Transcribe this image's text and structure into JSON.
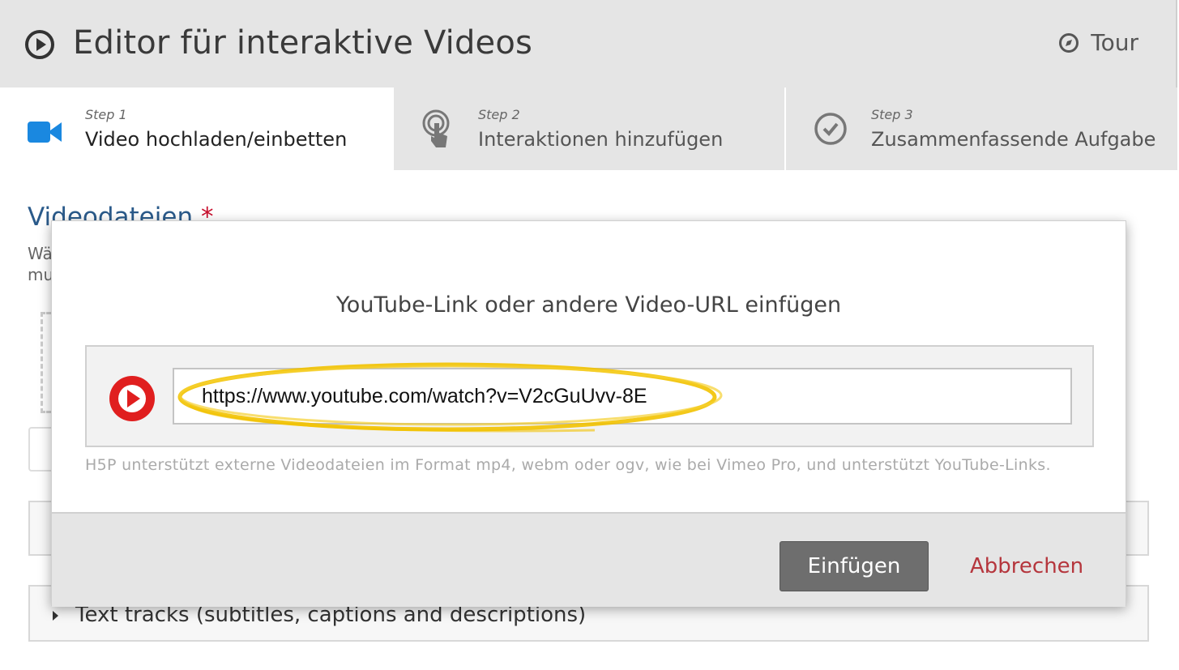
{
  "header": {
    "title": "Editor für interaktive Videos",
    "tour_label": "Tour"
  },
  "steps": [
    {
      "number": "Step 1",
      "label": "Video hochladen/einbetten",
      "icon": "video-camera-icon",
      "active": true
    },
    {
      "number": "Step 2",
      "label": "Interaktionen hinzufügen",
      "icon": "touch-hand-icon",
      "active": false
    },
    {
      "number": "Step 3",
      "label": "Zusammenfassende Aufgabe",
      "icon": "check-circle-icon",
      "active": false
    }
  ],
  "background": {
    "field_title": "Videodateien",
    "required_mark": "*",
    "description_line1": "Wä",
    "description_line2": "mu",
    "text_tracks_label": "Text tracks (subtitles, captions and descriptions)"
  },
  "modal": {
    "title": "YouTube-Link oder andere Video-URL einfügen",
    "url_value": "https://www.youtube.com/watch?v=V2cGuUvv-8E",
    "hint": "H5P unterstützt externe Videodateien im Format mp4, webm oder ogv, wie bei Vimeo Pro, und unterstützt YouTube-Links.",
    "insert_label": "Einfügen",
    "cancel_label": "Abbrechen"
  },
  "colors": {
    "header_bg": "#e5e5e5",
    "step_active_icon": "#1a88e0",
    "youtube_red": "#e01f1f",
    "highlight_yellow": "#f2c200",
    "cancel_red": "#b5363d",
    "insert_button": "#6e6e6e"
  }
}
